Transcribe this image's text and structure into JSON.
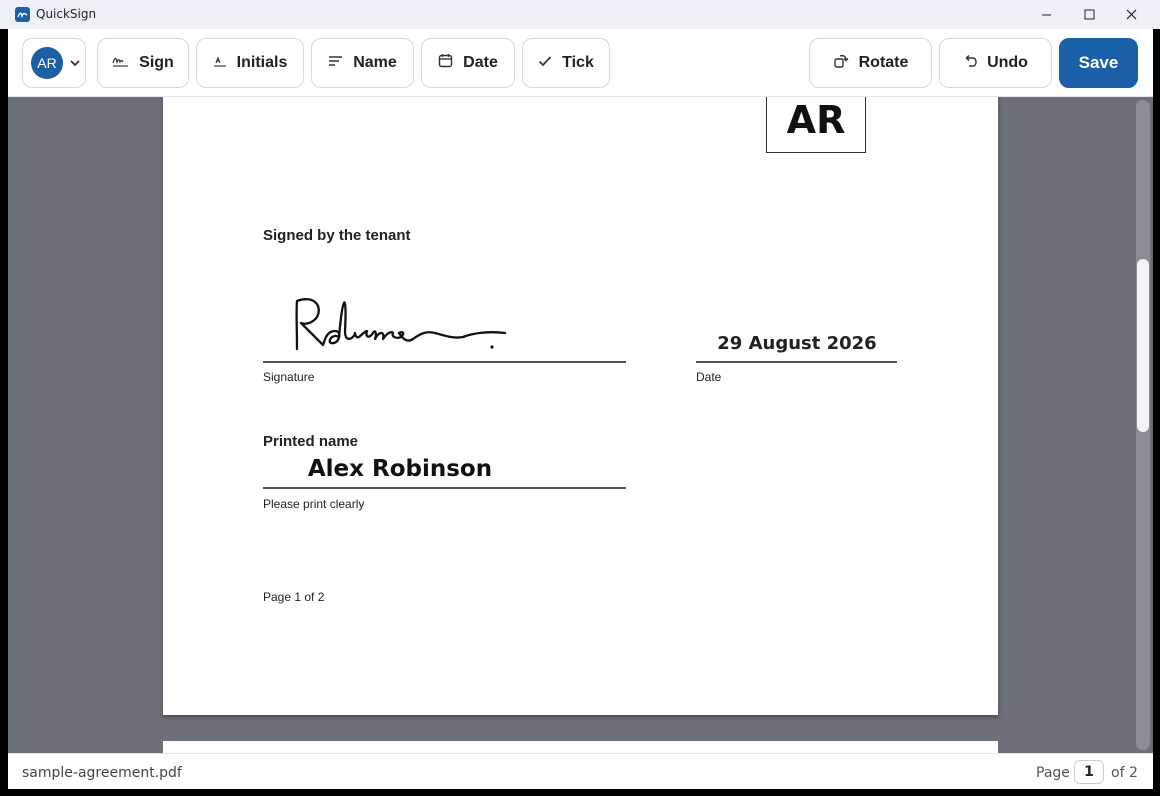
{
  "app": {
    "title": "QuickSign"
  },
  "toolbar": {
    "avatar_initials": "AR",
    "sign_label": "Sign",
    "initials_label": "Initials",
    "name_label": "Name",
    "date_label": "Date",
    "tick_label": "Tick",
    "rotate_label": "Rotate",
    "undo_label": "Undo",
    "save_label": "Save"
  },
  "document": {
    "initials_stamp": "AR",
    "signed_by_heading": "Signed by the tenant",
    "signature_caption": "Signature",
    "signature_text": "Robinson",
    "date_value": "29 August 2026",
    "date_caption": "Date",
    "printed_name_heading": "Printed name",
    "printed_name_value": "Alex Robinson",
    "printed_name_caption": "Please print clearly",
    "page_footer": "Page 1 of 2"
  },
  "status": {
    "filename": "sample-agreement.pdf",
    "page_label": "Page",
    "current_page": "1",
    "page_total_label": "of 2"
  },
  "colors": {
    "accent": "#1a5fa8",
    "viewer_background": "#6b7079"
  }
}
